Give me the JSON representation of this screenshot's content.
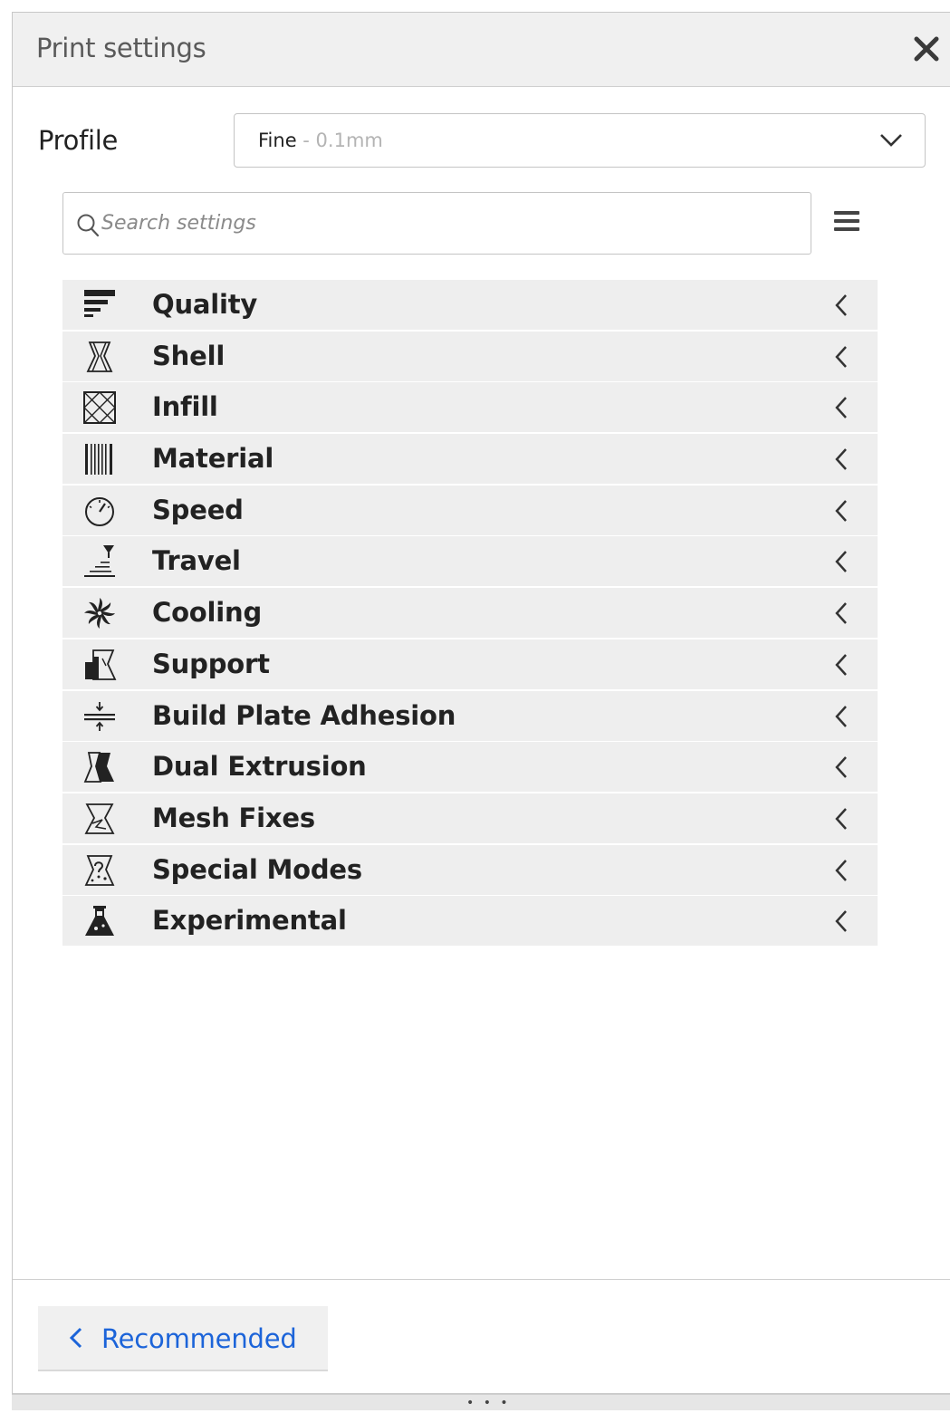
{
  "header": {
    "title": "Print settings",
    "close_icon": "close-icon"
  },
  "profile": {
    "label": "Profile",
    "selected_name": "Fine",
    "selected_detail": " - 0.1mm"
  },
  "search": {
    "placeholder": "Search settings",
    "value": ""
  },
  "categories": [
    {
      "label": "Quality",
      "icon": "quality-icon"
    },
    {
      "label": "Shell",
      "icon": "shell-icon"
    },
    {
      "label": "Infill",
      "icon": "infill-icon"
    },
    {
      "label": "Material",
      "icon": "material-icon"
    },
    {
      "label": "Speed",
      "icon": "speed-icon"
    },
    {
      "label": "Travel",
      "icon": "travel-icon"
    },
    {
      "label": "Cooling",
      "icon": "cooling-icon"
    },
    {
      "label": "Support",
      "icon": "support-icon"
    },
    {
      "label": "Build Plate Adhesion",
      "icon": "build-plate-adhesion-icon"
    },
    {
      "label": "Dual Extrusion",
      "icon": "dual-extrusion-icon"
    },
    {
      "label": "Mesh Fixes",
      "icon": "mesh-fixes-icon"
    },
    {
      "label": "Special Modes",
      "icon": "special-modes-icon"
    },
    {
      "label": "Experimental",
      "icon": "experimental-icon"
    }
  ],
  "footer": {
    "recommended_label": "Recommended",
    "drag_handle": "• • •"
  },
  "colors": {
    "accent": "#1c64d9",
    "category_bg": "#eeeeee",
    "header_bg": "#f0f0f0"
  }
}
